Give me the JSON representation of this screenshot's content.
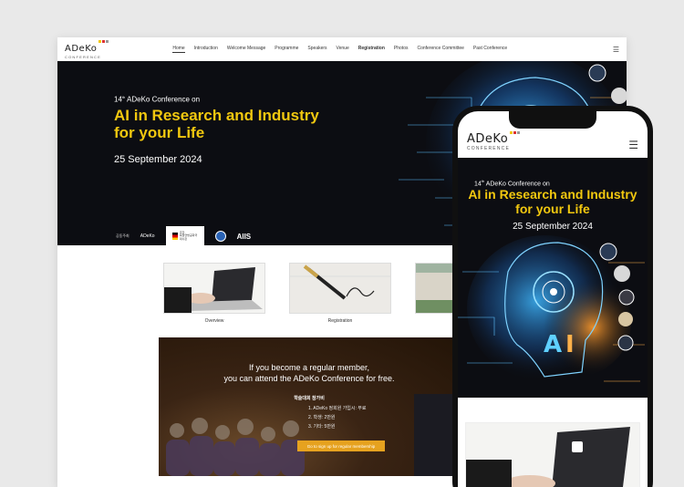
{
  "brand": {
    "word": "ADeKo",
    "sub": "CONFERENCE"
  },
  "nav": {
    "items": [
      "Home",
      "Introduction",
      "Welcome Message",
      "Programme",
      "Speakers",
      "Venue",
      "Registration",
      "Photos",
      "Conference Committee",
      "Past Conference"
    ],
    "active": "Home",
    "hamburger": "☰"
  },
  "hero": {
    "kicker_num": "14",
    "kicker_sup": "th",
    "kicker_rest": " ADeKo Conference on",
    "title_line1": "AI in Research and Industry",
    "title_line2": "for your Life",
    "date": "25 September 2024"
  },
  "sponsors": {
    "label": "공동주최",
    "s1": "ADeKo",
    "s2_line1": "주한",
    "s2_line2": "독일연방공화국",
    "s2_line3": "대사관",
    "s4": "AIIS"
  },
  "cards": [
    {
      "caption": "Overview"
    },
    {
      "caption": "Registration"
    }
  ],
  "banner": {
    "line1": "If you become a regular member,",
    "line2": "you can attend the ADeKo Conference for free.",
    "subhead": "학술대회 참가비",
    "list": [
      "1. ADeKo 정회원 가입시: 무료",
      "2. 학생: 2만원",
      "3. 기타: 5만원"
    ],
    "button": "Go to sign up for regular membership"
  },
  "colors": {
    "accent": "#f2c80f",
    "button": "#e6a21f",
    "hero_bg": "#0c0d12"
  }
}
